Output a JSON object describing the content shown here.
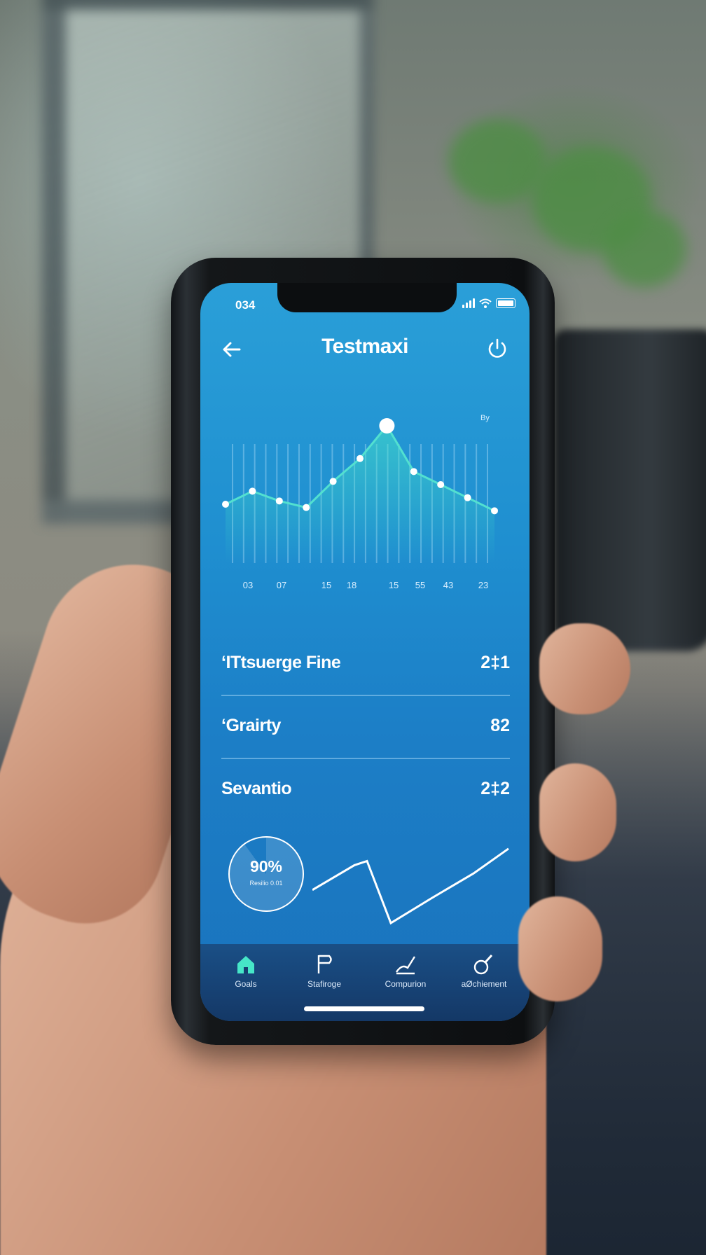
{
  "status_bar": {
    "time": "034"
  },
  "header": {
    "title": "Testmaxi"
  },
  "chart_data": {
    "type": "line",
    "title": "",
    "legend": "By",
    "x_tick_labels": [
      "03",
      "07",
      "15",
      "18",
      "15",
      "55",
      "43",
      "23"
    ],
    "values": [
      18,
      22,
      19,
      17,
      25,
      32,
      42,
      28,
      24,
      20,
      16
    ],
    "highlight_index": 6,
    "bars": 24
  },
  "list": {
    "items": [
      {
        "label": "‘ITtsuerge Fine",
        "value": "2‡1"
      },
      {
        "label": "‘Grairty",
        "value": "82"
      },
      {
        "label": "Sevantio",
        "value": "2‡2"
      }
    ]
  },
  "summary": {
    "gauge_value": "90%",
    "gauge_sub": "Resilio 0.01",
    "progress": 0.9,
    "trend_values": [
      4,
      7,
      7.5,
      0,
      3,
      6,
      9
    ]
  },
  "tabs": [
    {
      "label": "Goals",
      "icon": "home-icon"
    },
    {
      "label": "Stafiroge",
      "icon": "flag-icon"
    },
    {
      "label": "Compurion",
      "icon": "graph-icon"
    },
    {
      "label": "aØchiement",
      "icon": "achievement-icon"
    }
  ],
  "colors": {
    "screen_top": "#2a9fd8",
    "screen_bottom": "#1a73bd",
    "accent": "#46e6c8",
    "tabbar": "#163f70"
  }
}
